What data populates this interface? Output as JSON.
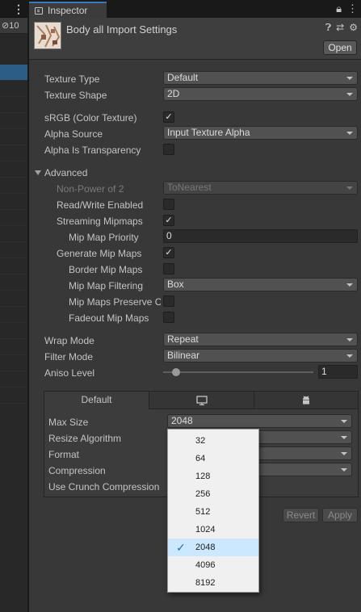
{
  "hierarchy": {
    "visible_count": "10"
  },
  "inspector": {
    "tab_label": "Inspector",
    "asset_title": "Body all Import Settings",
    "open_label": "Open"
  },
  "texture": {
    "texture_type_label": "Texture Type",
    "texture_type_value": "Default",
    "texture_shape_label": "Texture Shape",
    "texture_shape_value": "2D",
    "srgb_label": "sRGB (Color Texture)",
    "srgb_checked": true,
    "alpha_source_label": "Alpha Source",
    "alpha_source_value": "Input Texture Alpha",
    "alpha_transparency_label": "Alpha Is Transparency",
    "alpha_transparency_checked": false
  },
  "advanced": {
    "label": "Advanced",
    "non_power_label": "Non-Power of 2",
    "non_power_value": "ToNearest",
    "read_write_label": "Read/Write Enabled",
    "read_write_checked": false,
    "streaming_label": "Streaming Mipmaps",
    "streaming_checked": true,
    "mip_priority_label": "Mip Map Priority",
    "mip_priority_value": "0",
    "generate_mips_label": "Generate Mip Maps",
    "generate_mips_checked": true,
    "border_mips_label": "Border Mip Maps",
    "border_mips_checked": false,
    "mip_filtering_label": "Mip Map Filtering",
    "mip_filtering_value": "Box",
    "preserve_coverage_label": "Mip Maps Preserve C",
    "preserve_coverage_checked": false,
    "fadeout_label": "Fadeout Mip Maps",
    "fadeout_checked": false
  },
  "wrap": {
    "wrap_label": "Wrap Mode",
    "wrap_value": "Repeat",
    "filter_label": "Filter Mode",
    "filter_value": "Bilinear",
    "aniso_label": "Aniso Level",
    "aniso_value": "1"
  },
  "platform": {
    "tab_default": "Default",
    "max_size_label": "Max Size",
    "max_size_value": "2048",
    "resize_label": "Resize Algorithm",
    "format_label": "Format",
    "compression_label": "Compression",
    "crunch_label": "Use Crunch Compression"
  },
  "actions": {
    "revert_label": "Revert",
    "apply_label": "Apply"
  },
  "max_size_popup": {
    "options": [
      "32",
      "64",
      "128",
      "256",
      "512",
      "1024",
      "2048",
      "4096",
      "8192"
    ],
    "selected": "2048"
  }
}
